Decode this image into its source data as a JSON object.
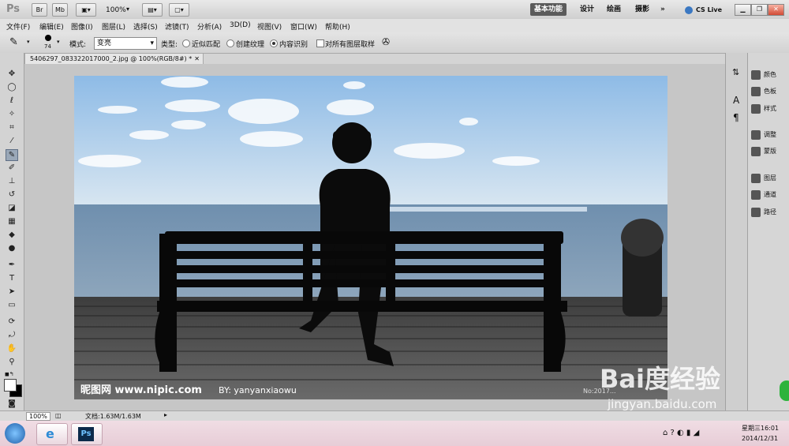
{
  "app": {
    "logo": "Ps",
    "bridge": "Br",
    "minibridge": "Mb",
    "zoom": "100%",
    "workspaces": [
      "基本功能",
      "设计",
      "绘画",
      "摄影"
    ],
    "more": "»",
    "cslive": "CS Live"
  },
  "menu": [
    "文件(F)",
    "编辑(E)",
    "图像(I)",
    "图层(L)",
    "选择(S)",
    "滤镜(T)",
    "分析(A)",
    "3D(D)",
    "视图(V)",
    "窗口(W)",
    "帮助(H)"
  ],
  "options": {
    "brush_size": "74",
    "mode_label": "模式:",
    "mode_value": "变亮",
    "type_label": "类型:",
    "type_options": [
      "近似匹配",
      "创建纹理",
      "内容识别"
    ],
    "sample_all": "对所有图层取样"
  },
  "document": {
    "tab": "5406297_083322017000_2.jpg @ 100%(RGB/8#) *",
    "watermark_left": "昵图网 www.nipic.com",
    "watermark_by": "BY: yanyanxiaowu",
    "watermark_no": "No:2017..."
  },
  "panels": [
    "颜色",
    "色板",
    "样式",
    "调整",
    "蒙版",
    "图层",
    "通道",
    "路径"
  ],
  "status": {
    "zoom": "100%",
    "doc": "文档:1.63M/1.63M"
  },
  "taskbar": {
    "date": "2014/12/31",
    "time": "星期三16:01"
  },
  "overlay": {
    "baidu": "Bai度经验",
    "url": "jingyan.baidu.com"
  },
  "colors": {
    "sky_top": "#9cc3e8",
    "sea": "#7f9cb6",
    "accent": "#5b5b5b"
  }
}
